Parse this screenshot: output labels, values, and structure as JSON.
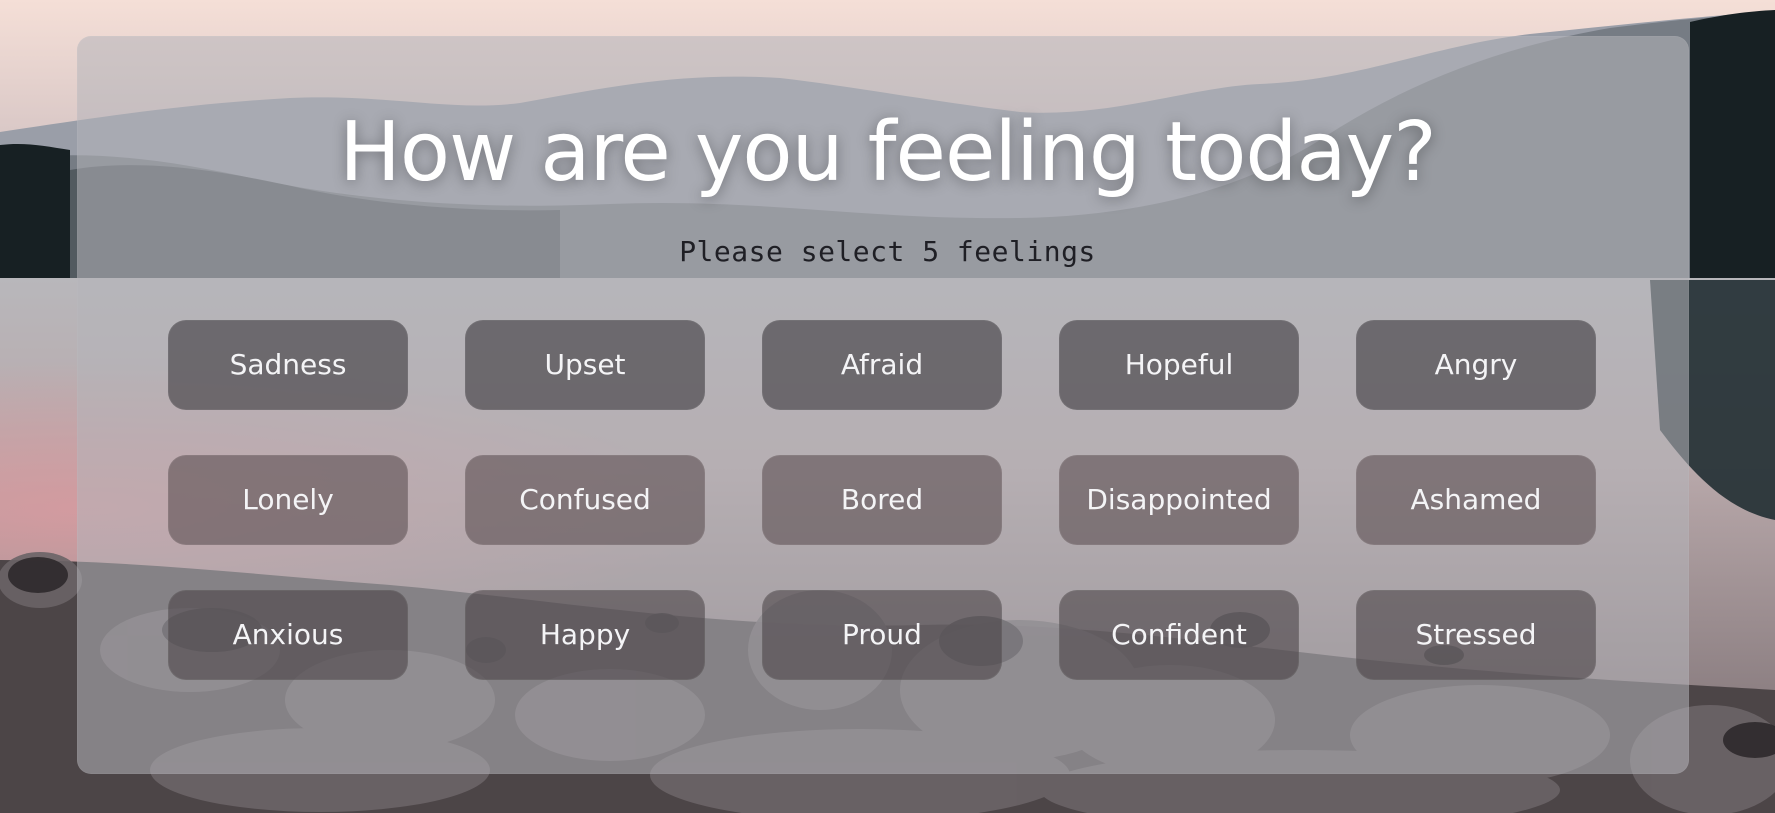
{
  "page": {
    "title": "How are you feeling today?",
    "subtitle": "Please select 5 feelings"
  },
  "feelings": [
    "Sadness",
    "Upset",
    "Afraid",
    "Hopeful",
    "Angry",
    "Lonely",
    "Confused",
    "Bored",
    "Disappointed",
    "Ashamed",
    "Anxious",
    "Happy",
    "Proud",
    "Confident",
    "Stressed"
  ],
  "colors": {
    "panel": "#B4B4BA",
    "button": "#464348",
    "title": "#FFFFFF",
    "subtitle": "#1F1F25"
  }
}
